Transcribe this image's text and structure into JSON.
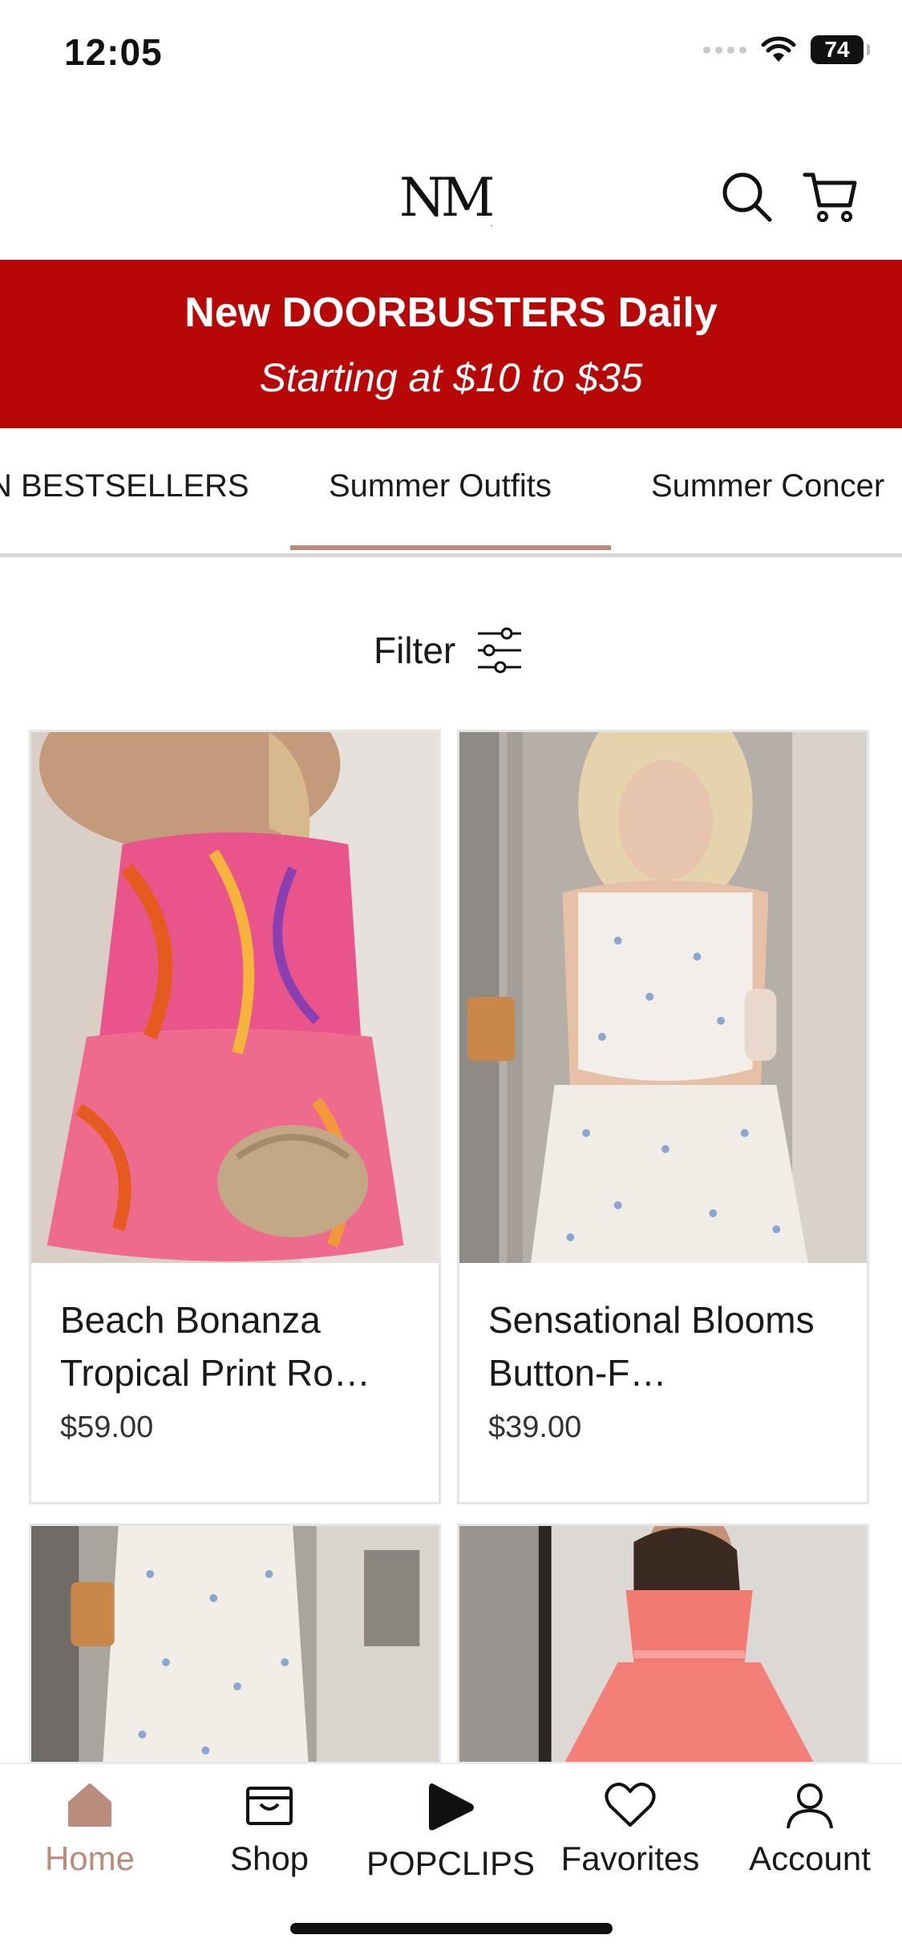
{
  "status_bar": {
    "time": "12:05",
    "battery": "74"
  },
  "header": {
    "logo": "NM",
    "logo_mark": "."
  },
  "promo": {
    "title": "New DOORBUSTERS Daily",
    "subtitle": "Starting at $10 to $35"
  },
  "tabs": [
    {
      "label": "N BESTSELLERS"
    },
    {
      "label": "Summer Outfits",
      "selected": true
    },
    {
      "label": "Summer Concer"
    }
  ],
  "filter": {
    "label": "Filter"
  },
  "products": [
    {
      "name": "Beach Bonanza Tropical Print Ro…",
      "price": "$59.00"
    },
    {
      "name": "Sensational Blooms Button-F…",
      "price": "$39.00"
    }
  ],
  "nav": {
    "home": "Home",
    "shop": "Shop",
    "popclips": "POPCLIPS",
    "favorites": "Favorites",
    "account": "Account"
  },
  "colors": {
    "promo_bg": "#b70707",
    "accent": "#b98c7d"
  }
}
